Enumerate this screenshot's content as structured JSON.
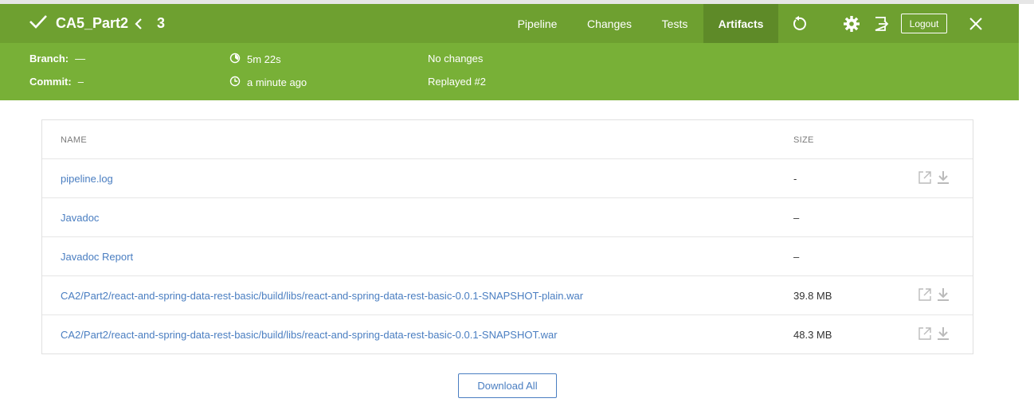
{
  "header": {
    "title": "CA5_Part2",
    "run_number": "3",
    "tabs": [
      {
        "label": "Pipeline",
        "active": false
      },
      {
        "label": "Changes",
        "active": false
      },
      {
        "label": "Tests",
        "active": false
      },
      {
        "label": "Artifacts",
        "active": true
      }
    ],
    "icons": [
      "checkmark-icon",
      "chevron-left-icon",
      "replay-icon",
      "gear-icon",
      "exit-icon",
      "close-icon"
    ],
    "logout_label": "Logout"
  },
  "summary": {
    "branch_label": "Branch:",
    "branch_value": "—",
    "commit_label": "Commit:",
    "commit_value": "–",
    "duration": "5m 22s",
    "time_ago": "a minute ago",
    "changes": "No changes",
    "replayed": "Replayed #2"
  },
  "artifacts": {
    "columns": {
      "name": "NAME",
      "size": "SIZE"
    },
    "rows": [
      {
        "name": "pipeline.log",
        "size": "-",
        "actions": true
      },
      {
        "name": "Javadoc",
        "size": "–",
        "actions": false
      },
      {
        "name": "Javadoc Report",
        "size": "–",
        "actions": false
      },
      {
        "name": "CA2/Part2/react-and-spring-data-rest-basic/build/libs/react-and-spring-data-rest-basic-0.0.1-SNAPSHOT-plain.war",
        "size": "39.8 MB",
        "actions": true
      },
      {
        "name": "CA2/Part2/react-and-spring-data-rest-basic/build/libs/react-and-spring-data-rest-basic-0.0.1-SNAPSHOT.war",
        "size": "48.3 MB",
        "actions": true
      }
    ],
    "download_all_label": "Download All"
  },
  "colors": {
    "header_bg": "#6ea030",
    "subheader_bg": "#78b037",
    "active_tab_bg": "#5e8a28",
    "link": "#4a7ec1"
  }
}
